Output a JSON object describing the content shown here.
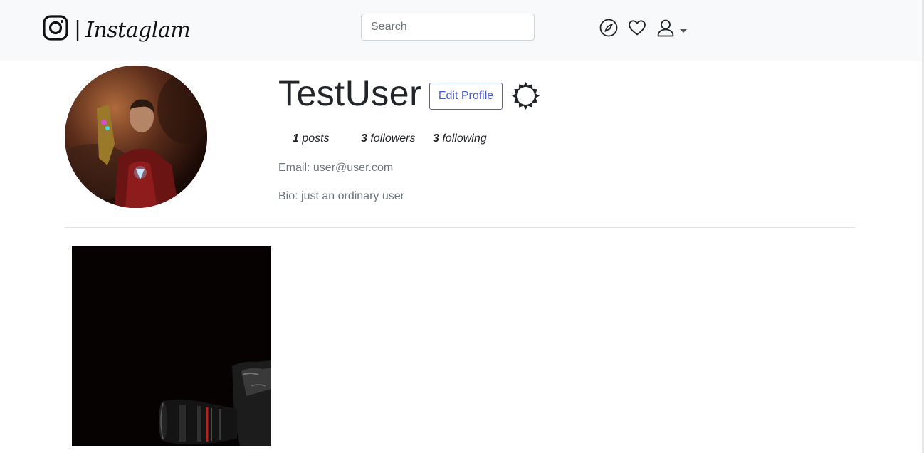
{
  "navbar": {
    "brand_separator": "|",
    "brand_name": "Instaglam",
    "search_placeholder": "Search",
    "search_value": "",
    "icons": [
      "instagram-icon",
      "compass-icon",
      "heart-icon",
      "user-icon",
      "caret-down-icon"
    ]
  },
  "profile": {
    "username": "TestUser",
    "edit_button": "Edit Profile",
    "settings_icon": "gear-icon",
    "stats": {
      "posts_count": "1",
      "posts_label": "posts",
      "followers_count": "3",
      "followers_label": "followers",
      "following_count": "3",
      "following_label": "following"
    },
    "email": "Email: user@user.com",
    "bio": "Bio: just an ordinary user"
  },
  "posts": [
    {
      "thumbnail": "camera-photo"
    }
  ],
  "colors": {
    "navbar_bg": "#f8f9fa",
    "accent": "#4d5bd9",
    "muted_text": "#6c757d"
  }
}
